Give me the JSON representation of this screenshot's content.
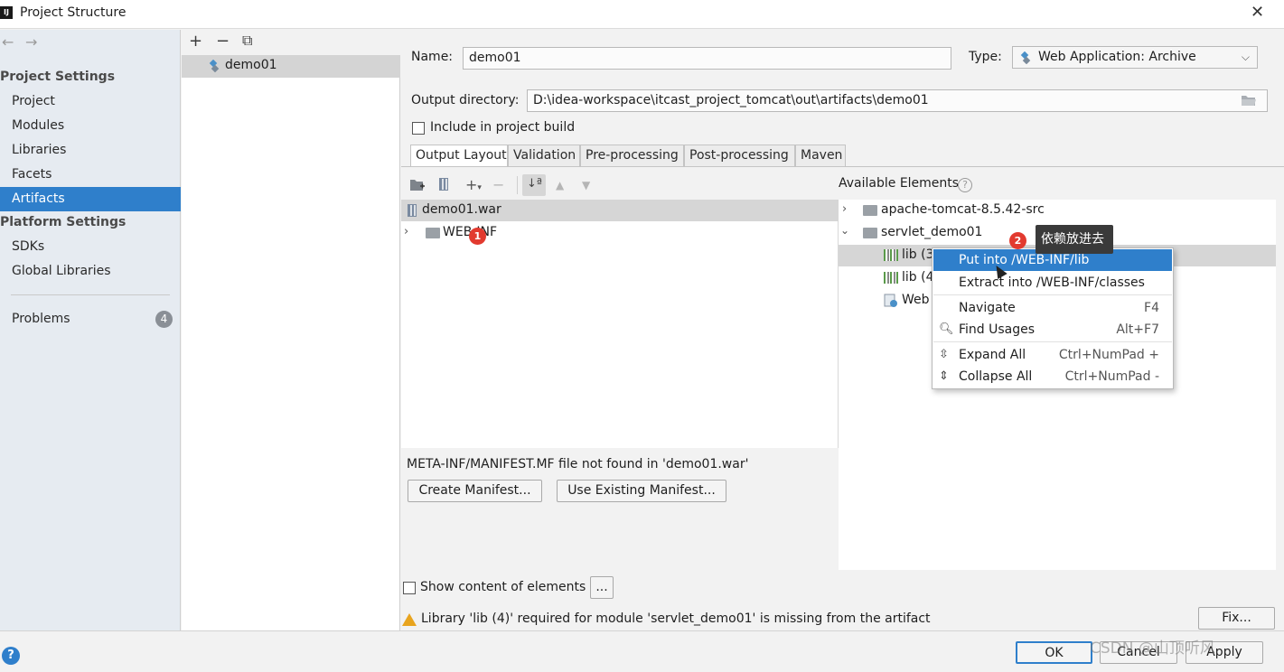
{
  "window": {
    "title": "Project Structure",
    "app_icon": "IJ"
  },
  "left_nav": {
    "back": "←",
    "forward": "→",
    "project_settings_title": "Project Settings",
    "project_settings_items": [
      "Project",
      "Modules",
      "Libraries",
      "Facets",
      "Artifacts"
    ],
    "platform_settings_title": "Platform Settings",
    "platform_settings_items": [
      "SDKs",
      "Global Libraries"
    ],
    "problems_label": "Problems",
    "problems_count": "4",
    "selected": "Artifacts"
  },
  "artifact_list": {
    "toolbar": {
      "add": "+",
      "remove": "−",
      "copy": "⧉"
    },
    "items": [
      "demo01"
    ]
  },
  "artifact": {
    "name_label": "Name:",
    "name_value": "demo01",
    "type_label": "Type:",
    "type_value": "Web Application: Archive",
    "output_dir_label": "Output directory:",
    "output_dir_value": "D:\\idea-workspace\\itcast_project_tomcat\\out\\artifacts\\demo01",
    "include_build_label": "Include in project build",
    "include_build_checked": false
  },
  "tabs": [
    "Output Layout",
    "Validation",
    "Pre-processing",
    "Post-processing",
    "Maven"
  ],
  "active_tab": "Output Layout",
  "output_tree": {
    "root": "demo01.war",
    "children": [
      "WEB-INF"
    ]
  },
  "available": {
    "title": "Available Elements",
    "items": [
      {
        "label": "apache-tomcat-8.5.42-src",
        "expanded": false
      },
      {
        "label": "servlet_demo01",
        "expanded": true
      }
    ],
    "servlet_children": [
      "lib (3",
      "lib (4",
      "Web"
    ]
  },
  "context_menu": {
    "items": [
      {
        "label": "Put into /WEB-INF/lib",
        "shortcut": "",
        "icon": "",
        "selected": true
      },
      {
        "label": "Extract into /WEB-INF/classes",
        "shortcut": "",
        "icon": ""
      },
      {
        "label": "Navigate",
        "shortcut": "F4",
        "icon": ""
      },
      {
        "label": "Find Usages",
        "shortcut": "Alt+F7",
        "icon": "search-icon"
      },
      {
        "label": "Expand All",
        "shortcut": "Ctrl+NumPad +",
        "icon": "expand-all-icon"
      },
      {
        "label": "Collapse All",
        "shortcut": "Ctrl+NumPad -",
        "icon": "collapse-all-icon"
      }
    ]
  },
  "annotations": {
    "badge1": "1",
    "badge2": "2",
    "tooltip": "依赖放进去"
  },
  "manifest": {
    "message": "META-INF/MANIFEST.MF file not found in 'demo01.war'",
    "create_button": "Create Manifest...",
    "use_existing_button": "Use Existing Manifest..."
  },
  "show_content": {
    "label": "Show content of elements",
    "checked": false,
    "more_button": "..."
  },
  "warning": {
    "text": "Library 'lib (4)' required for module 'servlet_demo01' is missing from the artifact",
    "fix_button": "Fix..."
  },
  "footer": {
    "ok": "OK",
    "cancel": "Cancel",
    "apply": "Apply",
    "help": "?"
  },
  "watermark": "CSDN @山顶听风",
  "colors": {
    "accent": "#2f7fcb",
    "selection": "#d4d4d4",
    "warning": "#e8a41e",
    "badge": "#e23a2f"
  }
}
